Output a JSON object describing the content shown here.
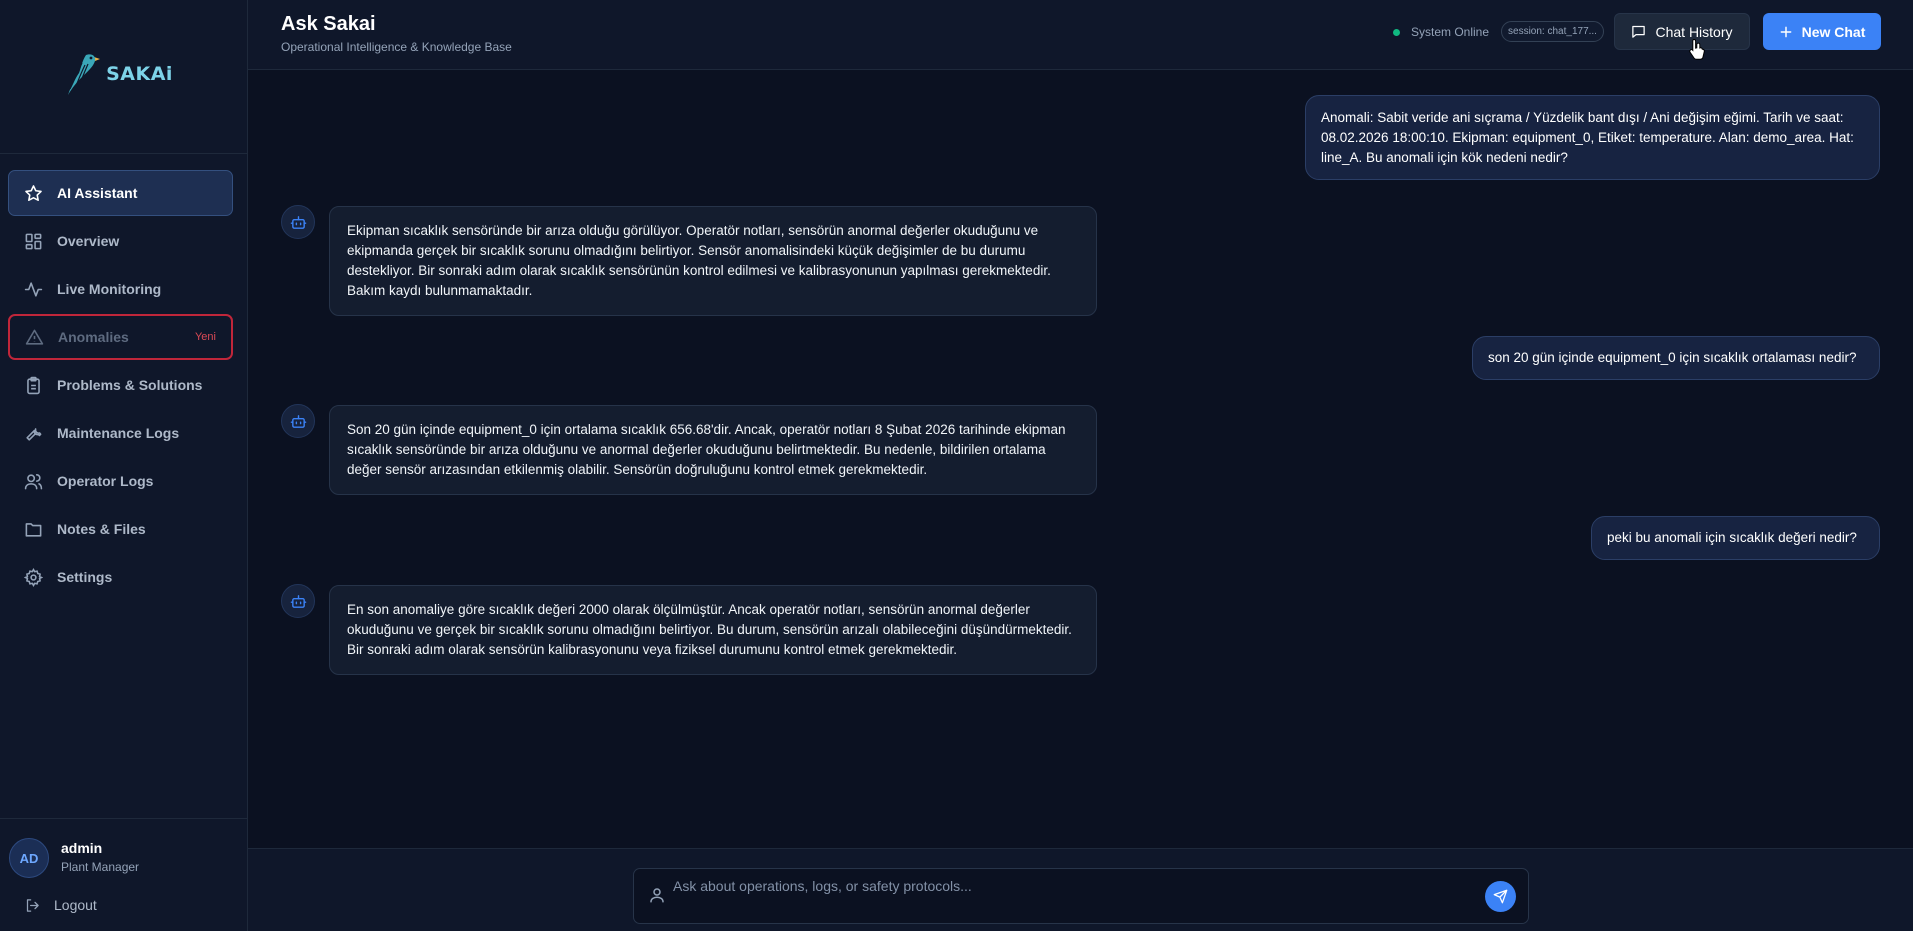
{
  "brand": {
    "logo_text": "SAKAi"
  },
  "sidebar": {
    "items": [
      {
        "label": "AI Assistant",
        "icon": "star-icon",
        "active": true
      },
      {
        "label": "Overview",
        "icon": "grid-icon"
      },
      {
        "label": "Live Monitoring",
        "icon": "activity-icon"
      },
      {
        "label": "Anomalies",
        "icon": "warning-icon",
        "badge": "Yeni"
      },
      {
        "label": "Problems & Solutions",
        "icon": "clipboard-icon"
      },
      {
        "label": "Maintenance Logs",
        "icon": "wrench-icon"
      },
      {
        "label": "Operator Logs",
        "icon": "users-icon"
      },
      {
        "label": "Notes & Files",
        "icon": "folder-icon"
      },
      {
        "label": "Settings",
        "icon": "gear-icon"
      }
    ]
  },
  "user": {
    "initials": "AD",
    "name": "admin",
    "role": "Plant Manager",
    "logout_label": "Logout"
  },
  "header": {
    "title": "Ask Sakai",
    "subtitle": "Operational Intelligence & Knowledge Base",
    "status_text": "System Online",
    "session_text": "session: chat_177...",
    "history_label": "Chat History",
    "new_chat_label": "New Chat"
  },
  "messages": [
    {
      "role": "user",
      "text": "Anomali: Sabit veride ani sıçrama / Yüzdelik bant dışı / Ani değişim eğimi. Tarih ve saat: 08.02.2026 18:00:10. Ekipman: equipment_0, Etiket: temperature. Alan: demo_area. Hat: line_A. Bu anomali için kök nedeni nedir?"
    },
    {
      "role": "assistant",
      "text": "Ekipman sıcaklık sensöründe bir arıza olduğu görülüyor. Operatör notları, sensörün anormal değerler okuduğunu ve ekipmanda gerçek bir sıcaklık sorunu olmadığını belirtiyor. Sensör anomalisindeki küçük değişimler de bu durumu destekliyor. Bir sonraki adım olarak sıcaklık sensörünün kontrol edilmesi ve kalibrasyonunun yapılması gerekmektedir. Bakım kaydı bulunmamaktadır."
    },
    {
      "role": "user",
      "text": "son 20 gün içinde equipment_0 için sıcaklık ortalaması nedir?"
    },
    {
      "role": "assistant",
      "text": "Son 20 gün içinde equipment_0 için ortalama sıcaklık 656.68'dir. Ancak, operatör notları 8 Şubat 2026 tarihinde ekipman sıcaklık sensöründe bir arıza olduğunu ve anormal değerler okuduğunu belirtmektedir. Bu nedenle, bildirilen ortalama değer sensör arızasından etkilenmiş olabilir. Sensörün doğruluğunu kontrol etmek gerekmektedir."
    },
    {
      "role": "user",
      "text": "peki bu anomali için sıcaklık değeri nedir?"
    },
    {
      "role": "assistant",
      "text": "En son anomaliye göre sıcaklık değeri 2000 olarak ölçülmüştür. Ancak operatör notları, sensörün anormal değerler okuduğunu ve gerçek bir sıcaklık sorunu olmadığını belirtiyor. Bu durum, sensörün arızalı olabileceğini düşündürmektedir. Bir sonraki adım olarak sensörün kalibrasyonunu veya fiziksel durumunu kontrol etmek gerekmektedir."
    }
  ],
  "input": {
    "value": "",
    "placeholder": "Ask about operations, logs, or safety protocols..."
  },
  "colors": {
    "accent": "#3b82f6",
    "online": "#10b981",
    "alert": "#c0263a"
  }
}
